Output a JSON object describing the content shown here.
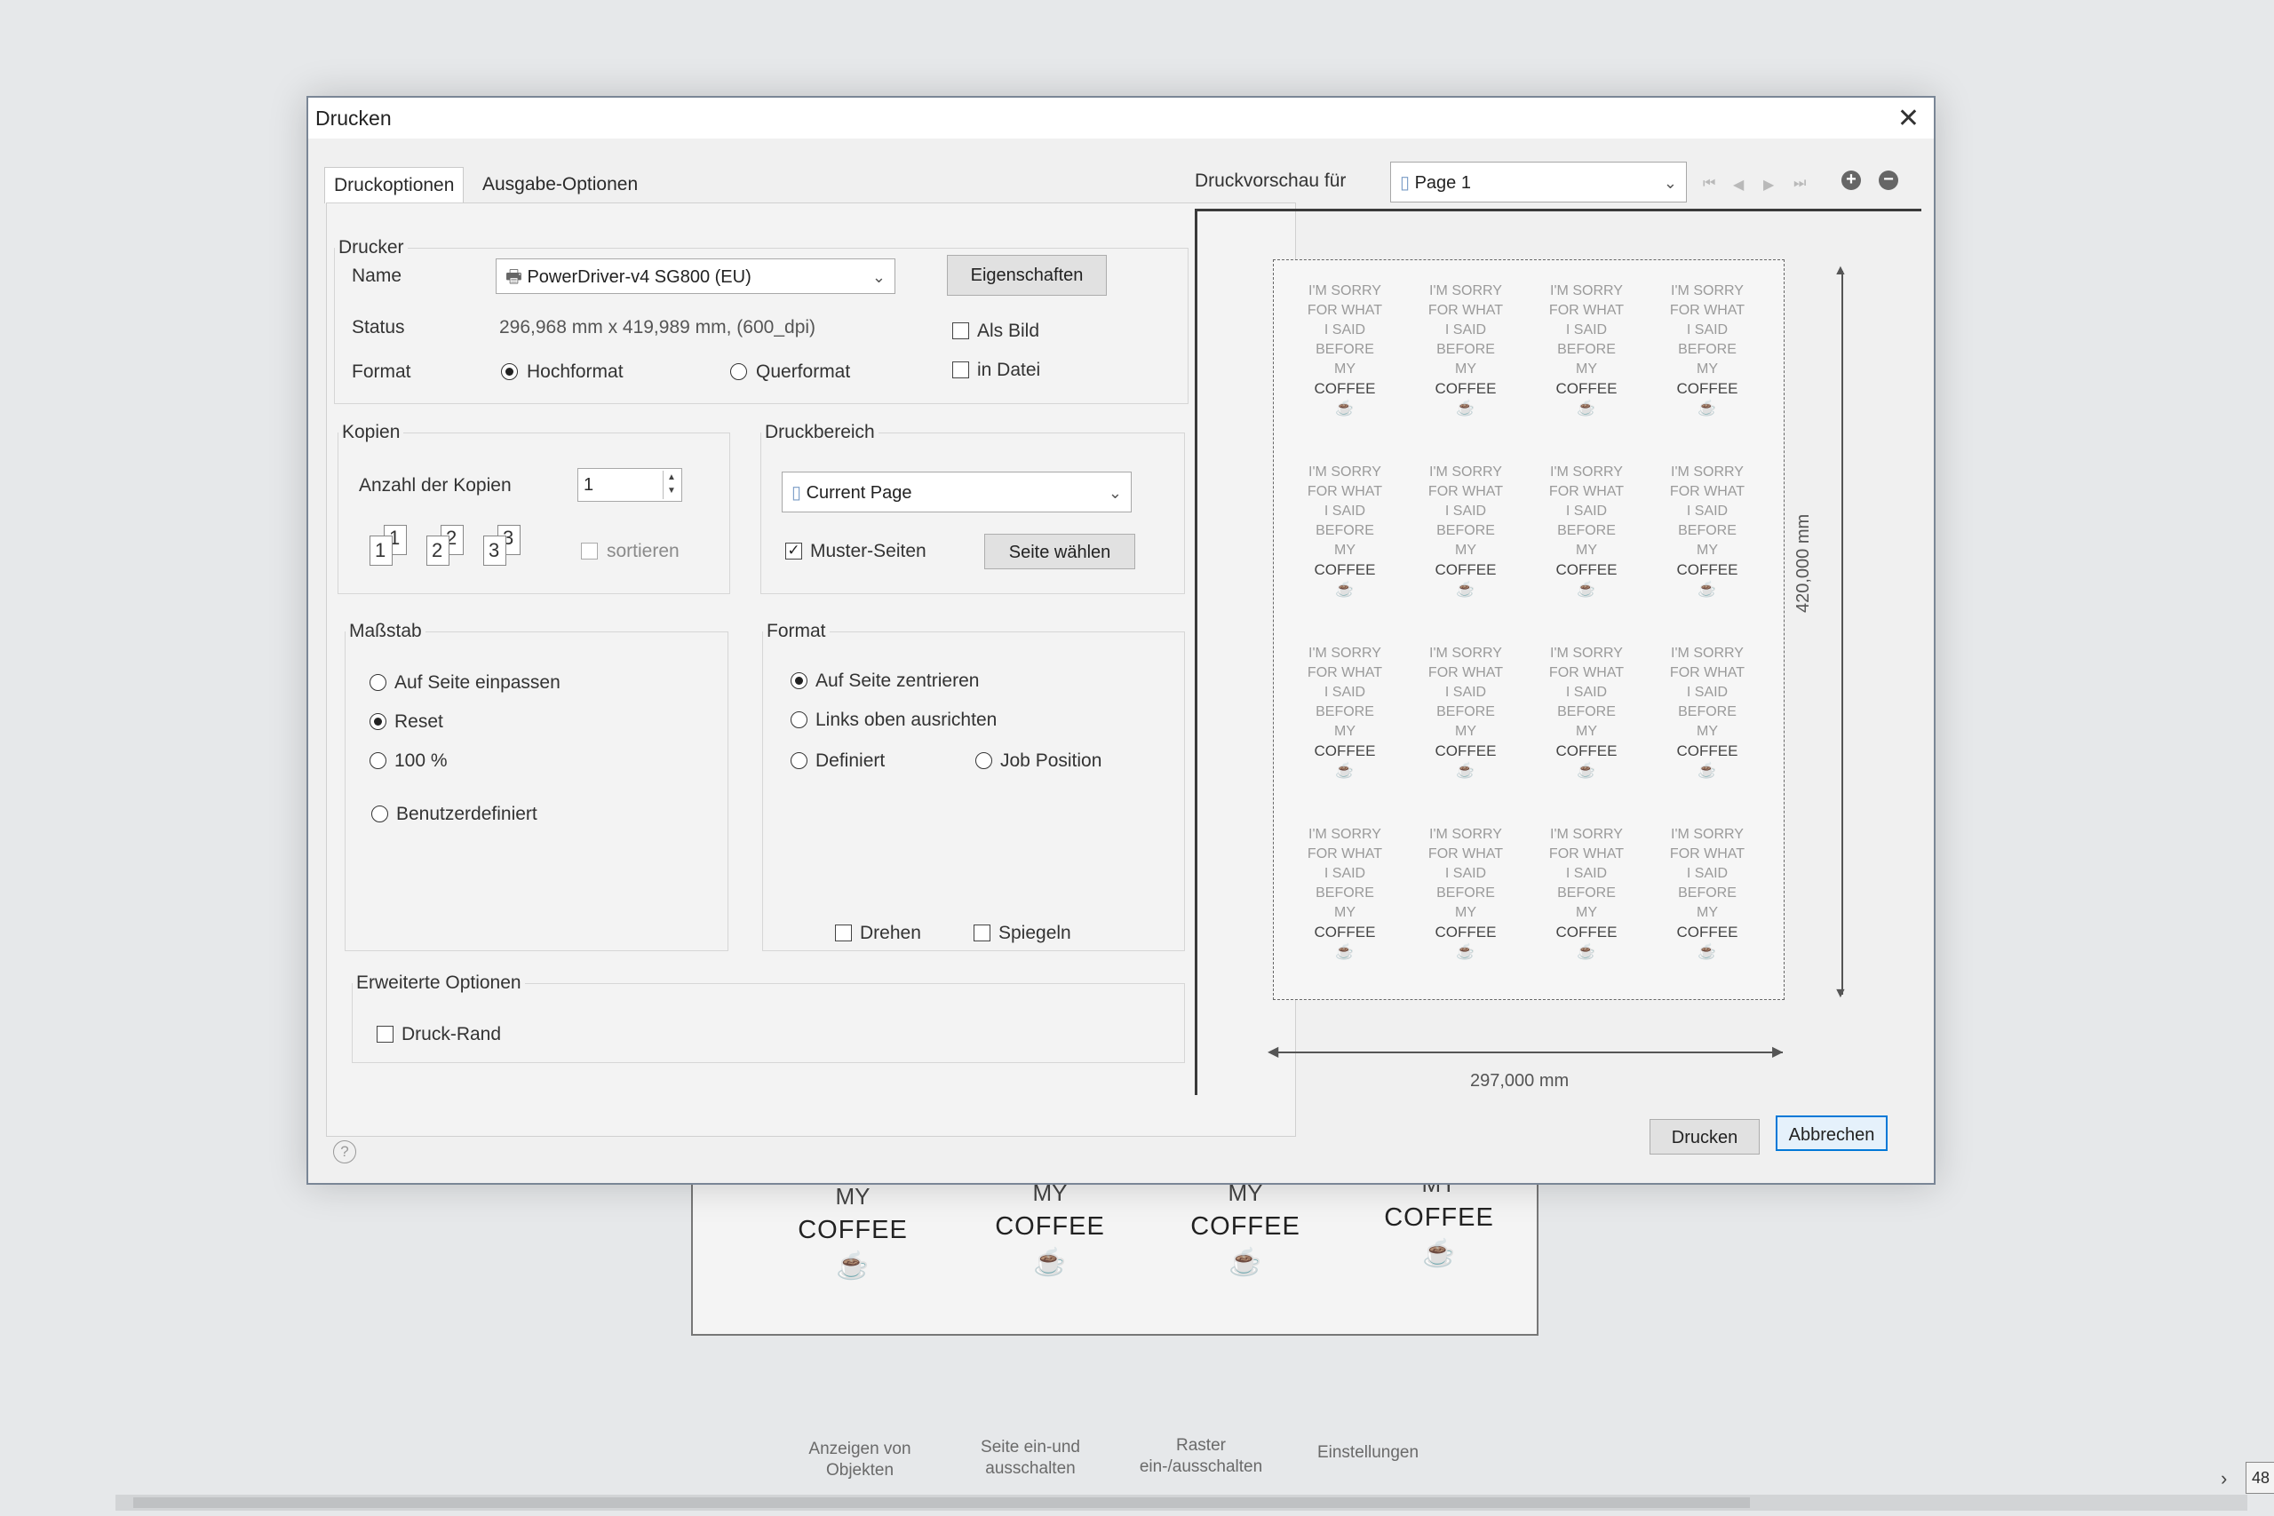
{
  "dialog": {
    "title": "Drucken",
    "tabs": [
      "Druckoptionen",
      "Ausgabe-Optionen"
    ],
    "printer": {
      "legend": "Drucker",
      "name_label": "Name",
      "name_value": "PowerDriver-v4 SG800 (EU)",
      "properties_button": "Eigenschaften",
      "status_label": "Status",
      "status_value": "296,968 mm x 419,989 mm, (600_dpi)",
      "format_label": "Format",
      "portrait": "Hochformat",
      "landscape": "Querformat",
      "as_image": "Als Bild",
      "to_file": "in Datei"
    },
    "copies": {
      "legend": "Kopien",
      "count_label": "Anzahl der Kopien",
      "count_value": "1",
      "collate": "sortieren"
    },
    "print_range": {
      "legend": "Druckbereich",
      "range_value": "Current Page",
      "master_pages": "Muster-Seiten",
      "select_page_button": "Seite wählen"
    },
    "scale": {
      "legend": "Maßstab",
      "fit_page": "Auf Seite einpassen",
      "reset": "Reset",
      "hundred": "100 %",
      "custom": "Benutzerdefiniert"
    },
    "format": {
      "legend": "Format",
      "center": "Auf Seite zentrieren",
      "top_left": "Links oben ausrichten",
      "defined": "Definiert",
      "job_position": "Job Position",
      "rotate": "Drehen",
      "mirror": "Spiegeln"
    },
    "advanced": {
      "legend": "Erweiterte Optionen",
      "print_border": "Druck-Rand"
    },
    "preview": {
      "label": "Druckvorschau für",
      "page_value": "Page 1",
      "height_dim": "420,000 mm",
      "width_dim": "297,000 mm"
    },
    "print_button": "Drucken",
    "cancel_button": "Abbrechen",
    "help_icon": "help-icon"
  },
  "sticker": {
    "line1": "I'M SORRY",
    "line2": "FOR WHAT",
    "line3": "I SAID",
    "line4": "BEFORE",
    "line5": "MY",
    "line6": "COFFEE",
    "cup_icon": "coffee-cup-icon"
  },
  "background": {
    "label_my": "MY",
    "label_coffee": "COFFEE",
    "tools": [
      "Anzeigen von Objekten",
      "Seite ein-und ausschalten",
      "Raster ein-/ausschalten",
      "Einstellungen"
    ],
    "zoom_value": "48"
  }
}
